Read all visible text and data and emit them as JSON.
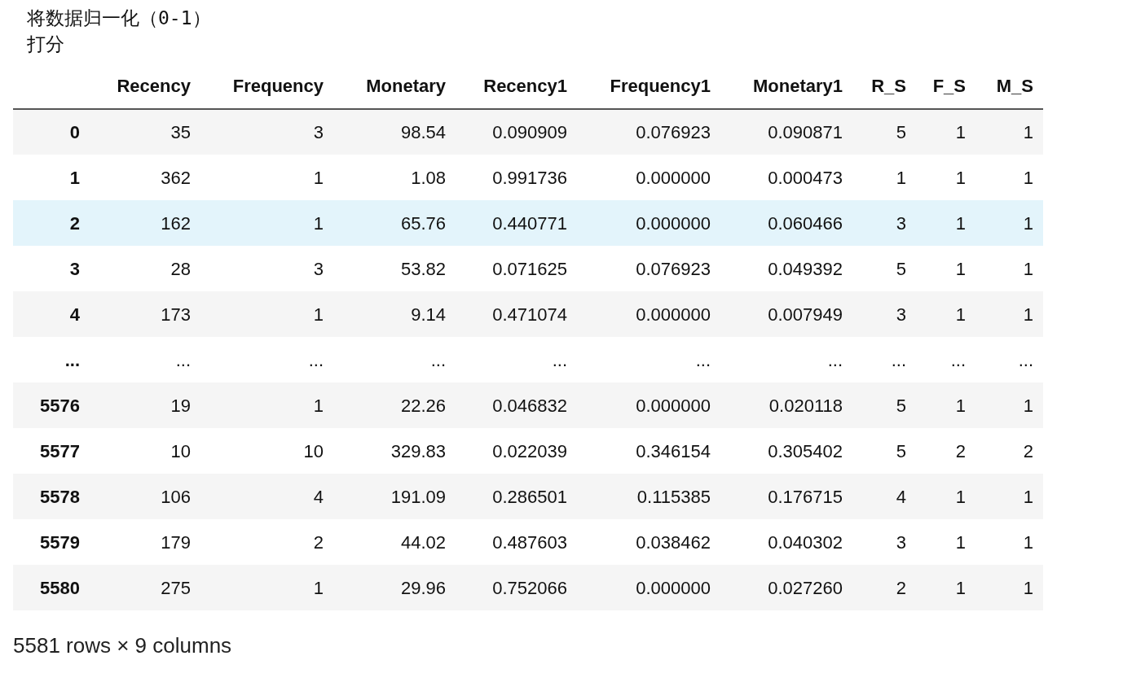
{
  "output_lines": [
    "将数据归一化（0-1）",
    "打分"
  ],
  "table": {
    "columns": [
      "Recency",
      "Frequency",
      "Monetary",
      "Recency1",
      "Frequency1",
      "Monetary1",
      "R_S",
      "F_S",
      "M_S"
    ],
    "rows": [
      {
        "index": "0",
        "cells": [
          "35",
          "3",
          "98.54",
          "0.090909",
          "0.076923",
          "0.090871",
          "5",
          "1",
          "1"
        ],
        "selected": false
      },
      {
        "index": "1",
        "cells": [
          "362",
          "1",
          "1.08",
          "0.991736",
          "0.000000",
          "0.000473",
          "1",
          "1",
          "1"
        ],
        "selected": false
      },
      {
        "index": "2",
        "cells": [
          "162",
          "1",
          "65.76",
          "0.440771",
          "0.000000",
          "0.060466",
          "3",
          "1",
          "1"
        ],
        "selected": true
      },
      {
        "index": "3",
        "cells": [
          "28",
          "3",
          "53.82",
          "0.071625",
          "0.076923",
          "0.049392",
          "5",
          "1",
          "1"
        ],
        "selected": false
      },
      {
        "index": "4",
        "cells": [
          "173",
          "1",
          "9.14",
          "0.471074",
          "0.000000",
          "0.007949",
          "3",
          "1",
          "1"
        ],
        "selected": false
      },
      {
        "index": "...",
        "cells": [
          "...",
          "...",
          "...",
          "...",
          "...",
          "...",
          "...",
          "...",
          "..."
        ],
        "selected": false
      },
      {
        "index": "5576",
        "cells": [
          "19",
          "1",
          "22.26",
          "0.046832",
          "0.000000",
          "0.020118",
          "5",
          "1",
          "1"
        ],
        "selected": false
      },
      {
        "index": "5577",
        "cells": [
          "10",
          "10",
          "329.83",
          "0.022039",
          "0.346154",
          "0.305402",
          "5",
          "2",
          "2"
        ],
        "selected": false
      },
      {
        "index": "5578",
        "cells": [
          "106",
          "4",
          "191.09",
          "0.286501",
          "0.115385",
          "0.176715",
          "4",
          "1",
          "1"
        ],
        "selected": false
      },
      {
        "index": "5579",
        "cells": [
          "179",
          "2",
          "44.02",
          "0.487603",
          "0.038462",
          "0.040302",
          "3",
          "1",
          "1"
        ],
        "selected": false
      },
      {
        "index": "5580",
        "cells": [
          "275",
          "1",
          "29.96",
          "0.752066",
          "0.000000",
          "0.027260",
          "2",
          "1",
          "1"
        ],
        "selected": false
      }
    ]
  },
  "summary": "5581 rows × 9 columns"
}
